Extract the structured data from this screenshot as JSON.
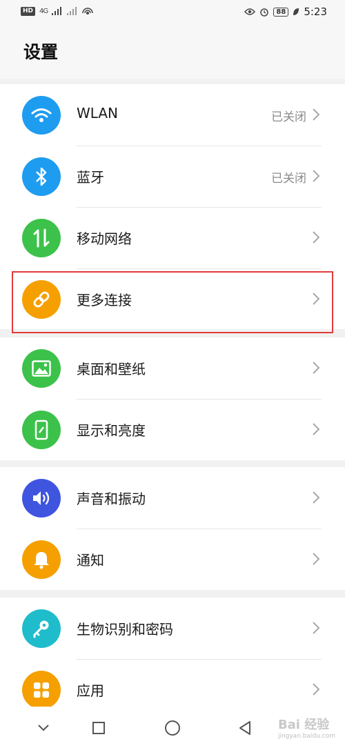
{
  "status_bar": {
    "hd_label": "HD",
    "network_label": "4G",
    "time": "5:23",
    "battery": "88",
    "icons": [
      "signal-icon",
      "signal-icon",
      "hotspot-icon",
      "eye-icon",
      "alarm-icon",
      "battery-icon",
      "leaf-icon"
    ]
  },
  "header": {
    "title": "设置"
  },
  "groups": [
    {
      "items": [
        {
          "label": "WLAN",
          "value": "已关闭",
          "icon": "wifi-icon",
          "color": "#1e9cf0"
        },
        {
          "label": "蓝牙",
          "value": "已关闭",
          "icon": "bluetooth-icon",
          "color": "#1e9cf0"
        },
        {
          "label": "移动网络",
          "value": "",
          "icon": "mobile-data-icon",
          "color": "#3cc24a"
        },
        {
          "label": "更多连接",
          "value": "",
          "icon": "link-icon",
          "color": "#f5a000"
        }
      ]
    },
    {
      "items": [
        {
          "label": "桌面和壁纸",
          "value": "",
          "icon": "wallpaper-icon",
          "color": "#3cc24a"
        },
        {
          "label": "显示和亮度",
          "value": "",
          "icon": "display-icon",
          "color": "#3cc24a"
        }
      ]
    },
    {
      "items": [
        {
          "label": "声音和振动",
          "value": "",
          "icon": "speaker-icon",
          "color": "#3f55e0"
        },
        {
          "label": "通知",
          "value": "",
          "icon": "bell-icon",
          "color": "#f5a000"
        }
      ]
    },
    {
      "items": [
        {
          "label": "生物识别和密码",
          "value": "",
          "icon": "key-icon",
          "color": "#1fbccb"
        },
        {
          "label": "应用",
          "value": "",
          "icon": "apps-icon",
          "color": "#f5a000"
        }
      ]
    }
  ],
  "highlight_color": "#e23b3b",
  "nav_bar": {
    "icons": [
      "collapse-icon",
      "recents-icon",
      "home-icon",
      "back-icon"
    ]
  },
  "watermark": {
    "text": "Bai 经验",
    "sub": "jingyan.baidu.com"
  }
}
